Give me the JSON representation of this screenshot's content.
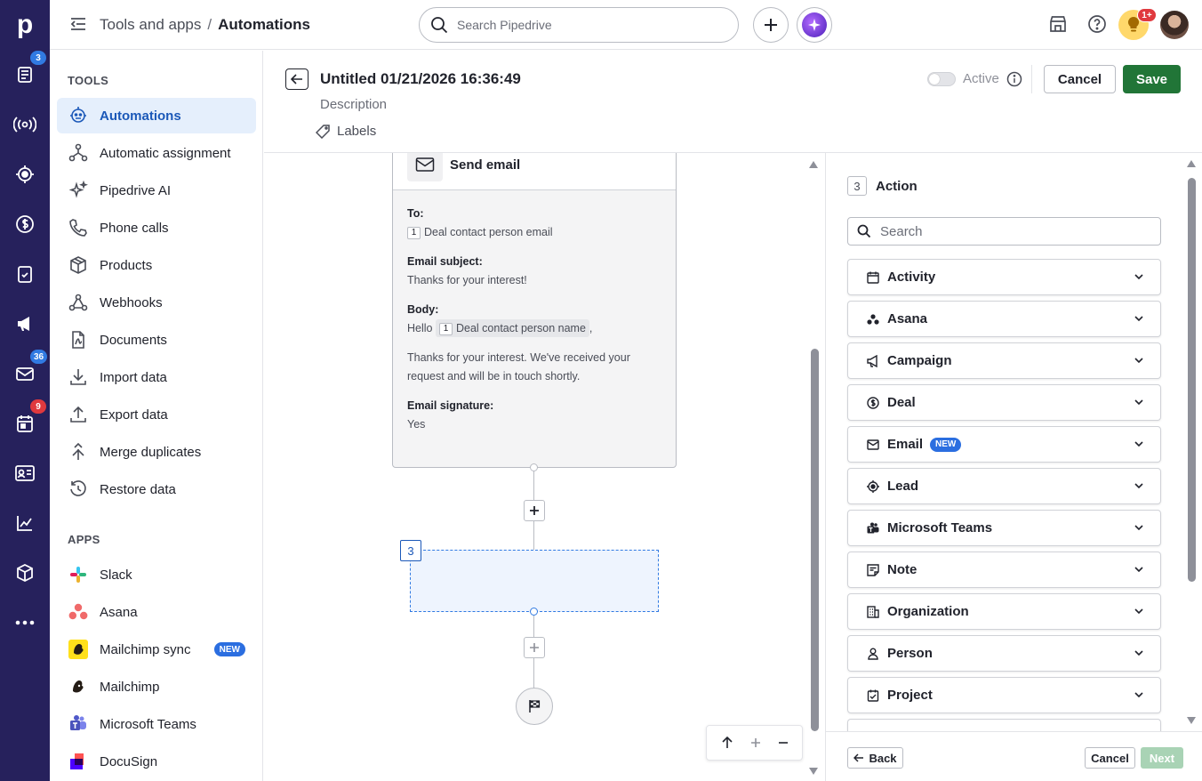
{
  "rail": {
    "logo": "p",
    "items": [
      {
        "icon": "deals-icon",
        "badge": "3"
      },
      {
        "icon": "broadcast-icon",
        "badge": ""
      },
      {
        "icon": "leads-target-icon",
        "badge": ""
      },
      {
        "icon": "dollar-icon",
        "badge": ""
      },
      {
        "icon": "tasks-icon",
        "badge": ""
      },
      {
        "icon": "campaign-megaphone-icon",
        "badge": ""
      },
      {
        "icon": "mail-icon",
        "badge": "36"
      },
      {
        "icon": "calendar-icon",
        "badge": "9"
      },
      {
        "icon": "contacts-card-icon",
        "badge": ""
      },
      {
        "icon": "insights-chart-icon",
        "badge": ""
      },
      {
        "icon": "products-box-icon",
        "badge": ""
      },
      {
        "icon": "more-icon",
        "badge": ""
      }
    ]
  },
  "topbar": {
    "breadcrumb_parent": "Tools and apps",
    "breadcrumb_sep": "/",
    "breadcrumb_current": "Automations",
    "search_placeholder": "Search Pipedrive",
    "notif_badge": "1+"
  },
  "sidebar": {
    "tools_title": "TOOLS",
    "tools": [
      {
        "label": "Automations",
        "icon": "automations-robot-icon",
        "active": true
      },
      {
        "label": "Automatic assignment",
        "icon": "assignment-icon"
      },
      {
        "label": "Pipedrive AI",
        "icon": "sparkles-icon"
      },
      {
        "label": "Phone calls",
        "icon": "phone-icon"
      },
      {
        "label": "Products",
        "icon": "box-icon"
      },
      {
        "label": "Webhooks",
        "icon": "webhook-icon"
      },
      {
        "label": "Documents",
        "icon": "document-icon"
      },
      {
        "label": "Import data",
        "icon": "import-icon"
      },
      {
        "label": "Export data",
        "icon": "export-icon"
      },
      {
        "label": "Merge duplicates",
        "icon": "merge-icon"
      },
      {
        "label": "Restore data",
        "icon": "restore-icon"
      }
    ],
    "apps_title": "APPS",
    "apps": [
      {
        "label": "Slack",
        "icon": "slack-icon"
      },
      {
        "label": "Asana",
        "icon": "asana-icon"
      },
      {
        "label": "Mailchimp sync",
        "icon": "mailchimp-icon",
        "badge": "NEW"
      },
      {
        "label": "Mailchimp",
        "icon": "mailchimp-icon"
      },
      {
        "label": "Microsoft Teams",
        "icon": "teams-icon"
      },
      {
        "label": "DocuSign",
        "icon": "docusign-icon"
      }
    ]
  },
  "header": {
    "title": "Untitled 01/21/2026 16:36:49",
    "description": "Description",
    "labels": "Labels",
    "active_label": "Active",
    "active_on": false,
    "cancel": "Cancel",
    "save": "Save"
  },
  "canvas": {
    "card_title": "Send email",
    "to_label": "To:",
    "to_token": "1",
    "to_value": "Deal contact person email",
    "subject_label": "Email subject:",
    "subject_value": "Thanks for your interest!",
    "body_label": "Body:",
    "body_hello": "Hello",
    "body_token": "1",
    "body_chip": "Deal contact person name",
    "body_comma": ",",
    "body_text": "Thanks for your interest. We've received your request and will be in touch shortly.",
    "signature_label": "Email signature:",
    "signature_value": "Yes",
    "step_number": "3"
  },
  "panel": {
    "step_number": "3",
    "title": "Action",
    "search_placeholder": "Search",
    "categories": [
      {
        "label": "Activity",
        "icon": "calendar-icon"
      },
      {
        "label": "Asana",
        "icon": "asana-icon"
      },
      {
        "label": "Campaign",
        "icon": "megaphone-icon"
      },
      {
        "label": "Deal",
        "icon": "dollar-icon"
      },
      {
        "label": "Email",
        "icon": "mail-icon",
        "badge": "NEW"
      },
      {
        "label": "Lead",
        "icon": "target-icon"
      },
      {
        "label": "Microsoft Teams",
        "icon": "teams-icon"
      },
      {
        "label": "Note",
        "icon": "note-icon"
      },
      {
        "label": "Organization",
        "icon": "building-icon"
      },
      {
        "label": "Person",
        "icon": "person-icon"
      },
      {
        "label": "Project",
        "icon": "project-icon"
      }
    ],
    "back": "Back",
    "cancel": "Cancel",
    "next": "Next"
  },
  "colors": {
    "rail_bg": "#26215c",
    "accent_blue": "#317ae2",
    "save_green": "#217537",
    "next_disabled": "#a9d3b5",
    "badge_red": "#e0393e"
  }
}
